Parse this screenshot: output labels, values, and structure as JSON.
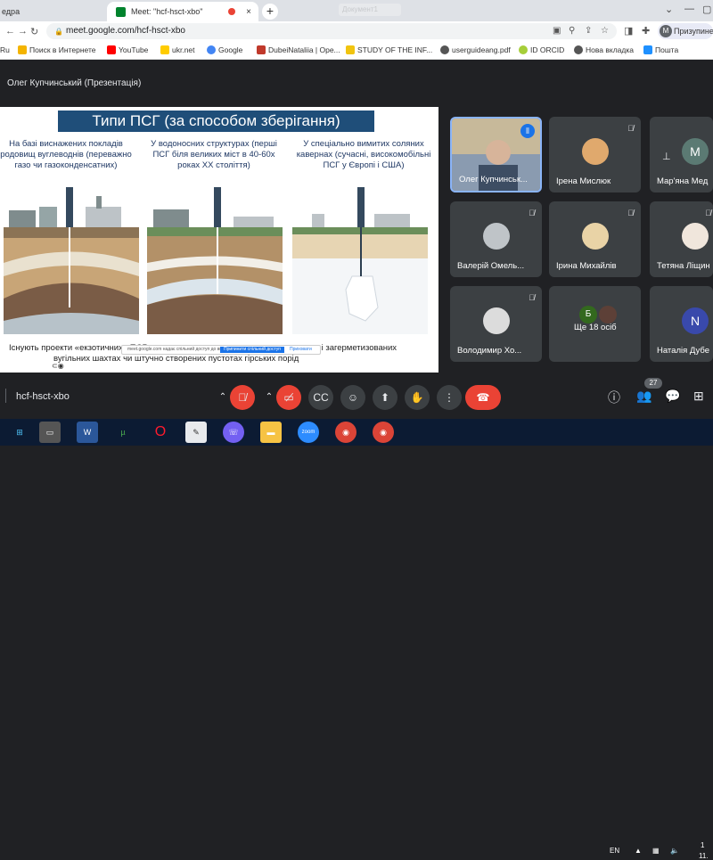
{
  "browser": {
    "tabs": [
      {
        "title": "едра"
      },
      {
        "title": "Meet: \"hcf-hsct-xbo\"",
        "close": "×"
      }
    ],
    "ghost_tab": "Документ1",
    "new_tab": "+",
    "url": "meet.google.com/hcf-hsct-xbo",
    "profile_initial": "M",
    "profile_label": "Призупинено",
    "bookmarks": [
      {
        "label": "Ru"
      },
      {
        "label": "Поиск в Интернете"
      },
      {
        "label": "YouTube"
      },
      {
        "label": "ukr.net"
      },
      {
        "label": "Google"
      },
      {
        "label": "DubeiNataliia | Ope..."
      },
      {
        "label": "STUDY OF THE INF..."
      },
      {
        "label": "userguideang.pdf"
      },
      {
        "label": "ID ORCID"
      },
      {
        "label": "Нова вкладка"
      },
      {
        "label": "Пошта"
      }
    ]
  },
  "meet": {
    "presenter_label": "Олег Купчинський (Презентація)",
    "meeting_code": "hcf-hsct-xbo",
    "participant_count": "27",
    "slide": {
      "title": "Типи ПСГ (за способом зберігання)",
      "columns": [
        {
          "text": "На базі виснажених покладів родовищ вуглеводнів (переважно газо чи газоконденсатних)"
        },
        {
          "text": "У водоносних структурах (перші ПСГ біля великих міст в 40-60х роках ХХ століття)"
        },
        {
          "text": "У спеціально вимитих соляних кавернах (сучасні, високомобільні ПСГ у Європі і США)"
        }
      ],
      "bottom_text_1": "Існують проекти «екзотичних» ПСГ у",
      "bottom_text_1b": "них і загерметизованих",
      "bottom_text_2": "вугільних шахтах чи штучно створених пустотах гірських порід",
      "share_notice": "meet.google.com надає спільний доступ до вкладки",
      "share_stop": "Припинити спільний доступ",
      "share_hide": "Приховати"
    },
    "participants": [
      {
        "name": "Олег Купчинськ...",
        "speaking": true
      },
      {
        "name": "Ірена Мислюк",
        "muted": true
      },
      {
        "name": "Мар'яна Мед",
        "initial": "M"
      },
      {
        "name": "Валерій Омель...",
        "muted": true
      },
      {
        "name": "Ірина Михайлів",
        "muted": true
      },
      {
        "name": "Тетяна Ліщин",
        "muted": true
      },
      {
        "name": "Володимир Хо...",
        "muted": true
      },
      {
        "name": "Ще 18 осіб",
        "initial": "Б"
      },
      {
        "name": "Наталія Дубе",
        "initial": "N"
      }
    ]
  },
  "taskbar": {
    "lang": "EN",
    "time": "1",
    "date": "11."
  },
  "colors": {
    "accent": "#1a73e8",
    "danger": "#ea4335",
    "meet_bg": "#202124",
    "tile_bg": "#3c4043",
    "slide_title_bg": "#1f4e79"
  }
}
